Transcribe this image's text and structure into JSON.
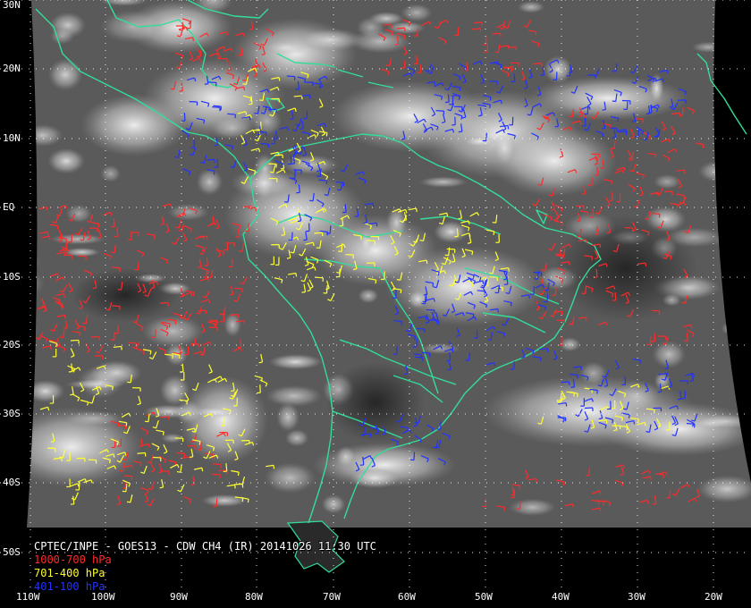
{
  "caption": {
    "title": "CPTEC/INPE - GOES13 - CDW CH4 (IR) 20141026 11:30 UTC",
    "legend": [
      {
        "label": "1000-700 hPa",
        "color": "#ff2a2a"
      },
      {
        "label": "701-400 hPa",
        "color": "#ffff33"
      },
      {
        "label": "401-100 hPa",
        "color": "#2233ff"
      }
    ]
  },
  "lat_labels": [
    "30N",
    "20N",
    "10N",
    "EQ",
    "10S",
    "20S",
    "30S",
    "40S",
    "50S"
  ],
  "lon_labels": [
    "110W",
    "100W",
    "90W",
    "80W",
    "70W",
    "60W",
    "50W",
    "40W",
    "30W",
    "20W"
  ],
  "colors": {
    "background": "#000000",
    "coastline": "#33dd99",
    "grid": "#ffffff",
    "text": "#ffffff"
  }
}
